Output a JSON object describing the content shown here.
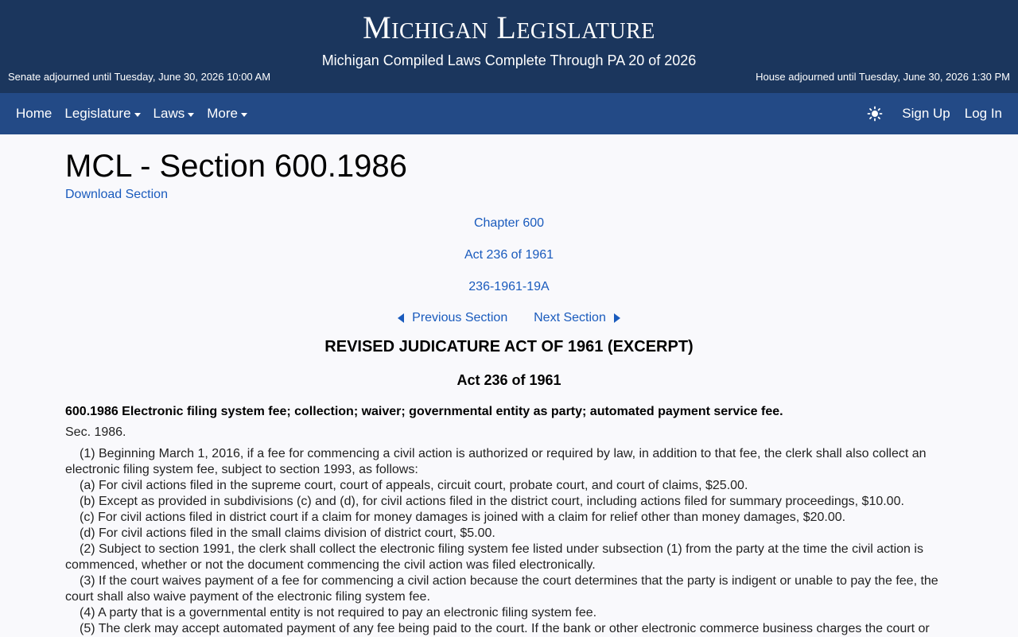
{
  "header": {
    "title": "Michigan Legislature",
    "subtitle": "Michigan Compiled Laws Complete Through PA 20 of 2026",
    "senate_status": "Senate adjourned until Tuesday, June 30, 2026 10:00 AM",
    "house_status": "House adjourned until Tuesday, June 30, 2026 1:30 PM"
  },
  "nav": {
    "home": "Home",
    "legislature": "Legislature",
    "laws": "Laws",
    "more": "More",
    "signup": "Sign Up",
    "login": "Log In",
    "theme_icon": "sun-icon"
  },
  "page": {
    "title": "MCL - Section 600.1986",
    "download": "Download Section",
    "chapter": "Chapter 600",
    "act": "Act 236 of 1961",
    "code": "236-1961-19A",
    "prev": "Previous Section",
    "next": "Next Section",
    "act_title": "REVISED JUDICATURE ACT OF 1961 (EXCERPT)",
    "act_sub": "Act 236 of 1961",
    "section_heading": "600.1986 Electronic filing system fee; collection; waiver; governmental entity as party; automated payment service fee.",
    "section_no": "Sec. 1986.",
    "paragraphs": [
      "(1) Beginning March 1, 2016, if a fee for commencing a civil action is authorized or required by law, in addition to that fee, the clerk shall also collect an electronic filing system fee, subject to section 1993, as follows:",
      "(a) For civil actions filed in the supreme court, court of appeals, circuit court, probate court, and court of claims, $25.00.",
      "(b) Except as provided in subdivisions (c) and (d), for civil actions filed in the district court, including actions filed for summary proceedings, $10.00.",
      "(c) For civil actions filed in district court if a claim for money damages is joined with a claim for relief other than money damages, $20.00.",
      "(d) For civil actions filed in the small claims division of district court, $5.00.",
      "(2) Subject to section 1991, the clerk shall collect the electronic filing system fee listed under subsection (1) from the party at the time the civil action is commenced, whether or not the document commencing the civil action was filed electronically.",
      "(3) If the court waives payment of a fee for commencing a civil action because the court determines that the party is indigent or unable to pay the fee, the court shall also waive payment of the electronic filing system fee.",
      "(4) A party that is a governmental entity is not required to pay an electronic filing system fee.",
      "(5) The clerk may accept automated payment of any fee being paid to the court. If the bank or other electronic commerce business charges the court or"
    ]
  }
}
